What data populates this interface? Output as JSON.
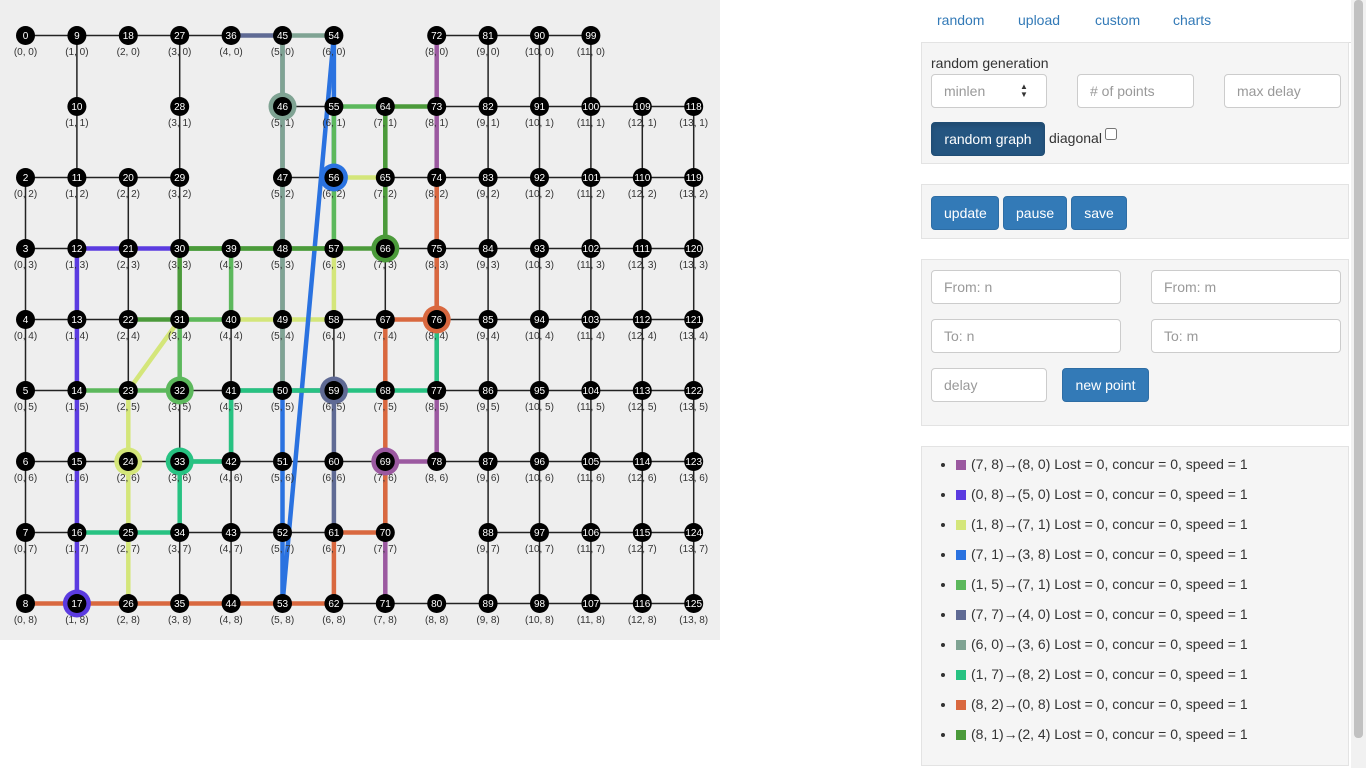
{
  "nav": {
    "tabs": [
      "random",
      "upload",
      "custom",
      "charts"
    ]
  },
  "random_generation": {
    "title": "random generation",
    "minlen_placeholder": "minlen",
    "points_placeholder": "# of points",
    "delay_placeholder": "max delay",
    "button": "random graph",
    "diagonal_label": "diagonal"
  },
  "controls": {
    "update": "update",
    "pause": "pause",
    "save": "save"
  },
  "new_point": {
    "from_n": "From: n",
    "from_m": "From: m",
    "to_n": "To: n",
    "to_m": "To: m",
    "delay": "delay",
    "button": "new point"
  },
  "routes": [
    {
      "color": "#9b59a0",
      "from": "(7, 8)",
      "to": "(8, 0)",
      "text": "Lost = 0, concur = 0, speed = 1",
      "path": [
        71,
        70,
        69,
        78,
        77,
        76,
        75,
        74,
        73,
        72
      ]
    },
    {
      "color": "#5b3be0",
      "from": "(0, 8)",
      "to": "(5, 0)",
      "text": "Lost = 0, concur = 0, speed = 1",
      "path": [
        17,
        16,
        15,
        14,
        13,
        12,
        21,
        30
      ]
    },
    {
      "color": "#d4e67a",
      "from": "(1, 8)",
      "to": "(7, 1)",
      "text": "Lost = 0, concur = 0, speed = 1",
      "path": [
        26,
        25,
        24,
        23,
        31,
        40,
        49,
        58,
        57,
        56,
        65
      ]
    },
    {
      "color": "#2a72e0",
      "from": "(7, 1)",
      "to": "(3, 8)",
      "text": "Lost = 0, concur = 0, speed = 1",
      "path": [
        56,
        55,
        54,
        53,
        52,
        51,
        50
      ]
    },
    {
      "color": "#5cb85c",
      "from": "(1, 5)",
      "to": "(7, 1)",
      "text": "Lost = 0, concur = 0, speed = 1",
      "path": [
        14,
        23,
        32,
        31,
        40,
        39,
        30,
        48,
        57,
        56,
        55,
        64,
        65,
        66
      ]
    },
    {
      "color": "#5f6a94",
      "from": "(7, 7)",
      "to": "(4, 0)",
      "text": "Lost = 0, concur = 0, speed = 1",
      "path": [
        61,
        60,
        59,
        50,
        49,
        48,
        47,
        46,
        45,
        36
      ]
    },
    {
      "color": "#7fa393",
      "from": "(6, 0)",
      "to": "(3, 6)",
      "text": "Lost = 0, concur = 0, speed = 1",
      "path": [
        54,
        45,
        46,
        47,
        48,
        49,
        50,
        41,
        42,
        33
      ]
    },
    {
      "color": "#27c282",
      "from": "(1, 7)",
      "to": "(8, 2)",
      "text": "Lost = 0, concur = 0, speed = 1",
      "path": [
        16,
        25,
        34,
        33,
        42,
        41,
        50,
        59,
        68,
        77,
        76
      ]
    },
    {
      "color": "#d9683f",
      "from": "(8, 2)",
      "to": "(0, 8)",
      "text": "Lost = 0, concur = 0, speed = 1",
      "path": [
        74,
        75,
        76,
        67,
        68,
        69,
        70,
        61,
        62,
        53,
        44,
        35,
        26,
        17,
        8
      ]
    },
    {
      "color": "#4b9a3a",
      "from": "(8, 1)",
      "to": "(2, 4)",
      "text": "Lost = 0, concur = 0, speed = 1",
      "path": [
        73,
        64,
        65,
        66,
        57,
        48,
        39,
        30,
        31,
        22
      ]
    }
  ],
  "graph": {
    "cols": 14,
    "rows": 9,
    "missing_nodes": [
      1,
      19,
      37,
      38,
      63,
      79,
      108,
      117
    ],
    "node_ring_colors": {
      "46": "#7fa393",
      "56": "#2a72e0",
      "66": "#4b9a3a",
      "76": "#d9683f",
      "32": "#5cb85c",
      "59": "#5f6a94",
      "24": "#d4e67a",
      "33": "#27c282",
      "69": "#9b59a0",
      "17": "#5b3be0"
    }
  }
}
